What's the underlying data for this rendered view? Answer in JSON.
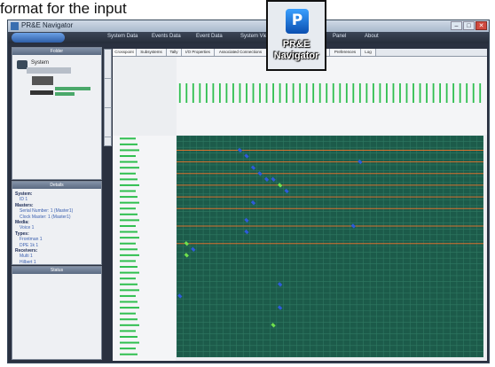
{
  "caption": "format for the input",
  "window": {
    "title": "PR&E Navigator",
    "menu": [
      {
        "label": "System Data"
      },
      {
        "label": "Events Data"
      },
      {
        "label": "Event Data"
      },
      {
        "label": "System View"
      },
      {
        "label": "Panel"
      },
      {
        "label": "About"
      }
    ]
  },
  "panes": {
    "top": {
      "title": "Folder",
      "tree": [
        {
          "label": "System"
        }
      ]
    },
    "middle": {
      "title": "Details",
      "entries": [
        {
          "label": "System:",
          "kind": "heading"
        },
        {
          "label": "ID 1",
          "kind": "item"
        },
        {
          "label": "Masters:",
          "kind": "heading"
        },
        {
          "label": "Serial Number: 1 (Master1)",
          "kind": "item"
        },
        {
          "label": "Clock Master: 1 (Master1)",
          "kind": "item"
        },
        {
          "label": "Media:",
          "kind": "heading"
        },
        {
          "label": "Voice 1",
          "kind": "item"
        },
        {
          "label": "Types:",
          "kind": "heading"
        },
        {
          "label": "Frontman 1",
          "kind": "item"
        },
        {
          "label": "DPE 1k 1",
          "kind": "item"
        },
        {
          "label": "Receivers:",
          "kind": "heading"
        },
        {
          "label": "Multi 1",
          "kind": "item"
        },
        {
          "label": "Hilbert 1",
          "kind": "item"
        }
      ]
    },
    "bottom": {
      "title": "Status"
    }
  },
  "tabs": [
    {
      "label": "Crosspoint",
      "active": true
    },
    {
      "label": "Subsystems"
    },
    {
      "label": "Tally"
    },
    {
      "label": "I/O Properties"
    },
    {
      "label": "Associated Connections"
    },
    {
      "label": "I/O"
    },
    {
      "label": "Keyboard"
    },
    {
      "label": "Status"
    },
    {
      "label": "Preferences"
    },
    {
      "label": "Log"
    }
  ],
  "grid": {
    "columns": 46,
    "rows": 38,
    "orange_rows": [
      2,
      4,
      6,
      8,
      10,
      12,
      15,
      18
    ],
    "points": [
      {
        "row": 2,
        "col": 9,
        "c": "#2e5bd9"
      },
      {
        "row": 3,
        "col": 10,
        "c": "#2e5bd9"
      },
      {
        "row": 4,
        "col": 27,
        "c": "#2e5bd9"
      },
      {
        "row": 5,
        "col": 11,
        "c": "#2e5bd9"
      },
      {
        "row": 6,
        "col": 12,
        "c": "#2e5bd9"
      },
      {
        "row": 7,
        "col": 13,
        "c": "#2e5bd9"
      },
      {
        "row": 7,
        "col": 14,
        "c": "#2e5bd9"
      },
      {
        "row": 8,
        "col": 15,
        "c": "#6fe04d"
      },
      {
        "row": 9,
        "col": 16,
        "c": "#2e5bd9"
      },
      {
        "row": 11,
        "col": 11,
        "c": "#2e5bd9"
      },
      {
        "row": 14,
        "col": 10,
        "c": "#2e5bd9"
      },
      {
        "row": 15,
        "col": 26,
        "c": "#2e5bd9"
      },
      {
        "row": 16,
        "col": 10,
        "c": "#2e5bd9"
      },
      {
        "row": 18,
        "col": 1,
        "c": "#6fe04d"
      },
      {
        "row": 19,
        "col": 2,
        "c": "#2e5bd9"
      },
      {
        "row": 20,
        "col": 1,
        "c": "#6fe04d"
      },
      {
        "row": 25,
        "col": 15,
        "c": "#2e5bd9"
      },
      {
        "row": 27,
        "col": 0,
        "c": "#2e5bd9"
      },
      {
        "row": 29,
        "col": 15,
        "c": "#2e5bd9"
      },
      {
        "row": 32,
        "col": 14,
        "c": "#6fe04d"
      }
    ]
  },
  "desktop_icon": {
    "label_line1": "PR&E",
    "label_line2": "Navigator"
  },
  "colors": {
    "grid_bg": "#1c5b4a",
    "grid_lines": "#2f7a63",
    "orange_line": "#d9712e",
    "label_green": "#2fbf4f"
  }
}
